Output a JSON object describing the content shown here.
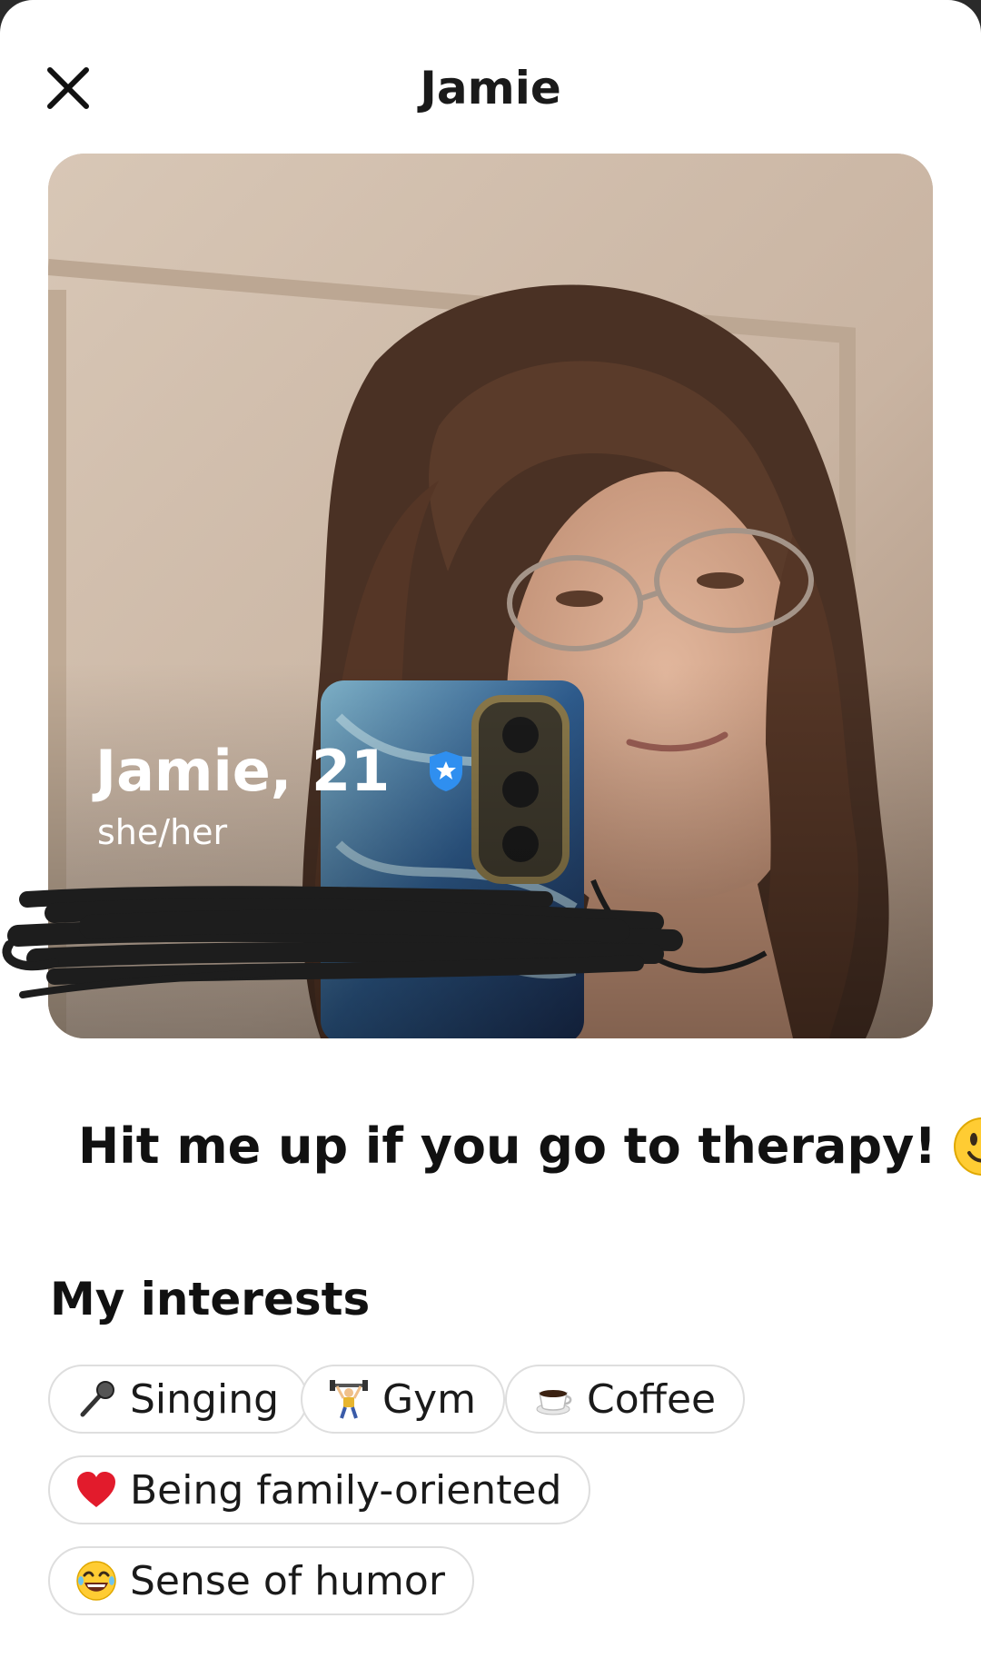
{
  "header": {
    "title": "Jamie",
    "close_icon": "close-icon"
  },
  "profile": {
    "name_age": "Jamie, 21",
    "pronouns": "she/her",
    "verified_icon": "verified-badge-icon",
    "badge_color": "#2f8ff0"
  },
  "bio": {
    "text": "Hit me up if you go to therapy!",
    "emoji": "winking-face-icon"
  },
  "interests": {
    "title": "My interests",
    "items": [
      {
        "label": "Singing",
        "icon": "microphone-icon"
      },
      {
        "label": "Gym",
        "icon": "weightlifter-icon"
      },
      {
        "label": "Coffee",
        "icon": "coffee-icon"
      },
      {
        "label": "Being family-oriented",
        "icon": "red-heart-icon"
      },
      {
        "label": "Sense of humor",
        "icon": "laughing-face-icon"
      }
    ]
  },
  "colors": {
    "text": "#111111",
    "chip_border": "#dedede",
    "background": "#ffffff"
  }
}
